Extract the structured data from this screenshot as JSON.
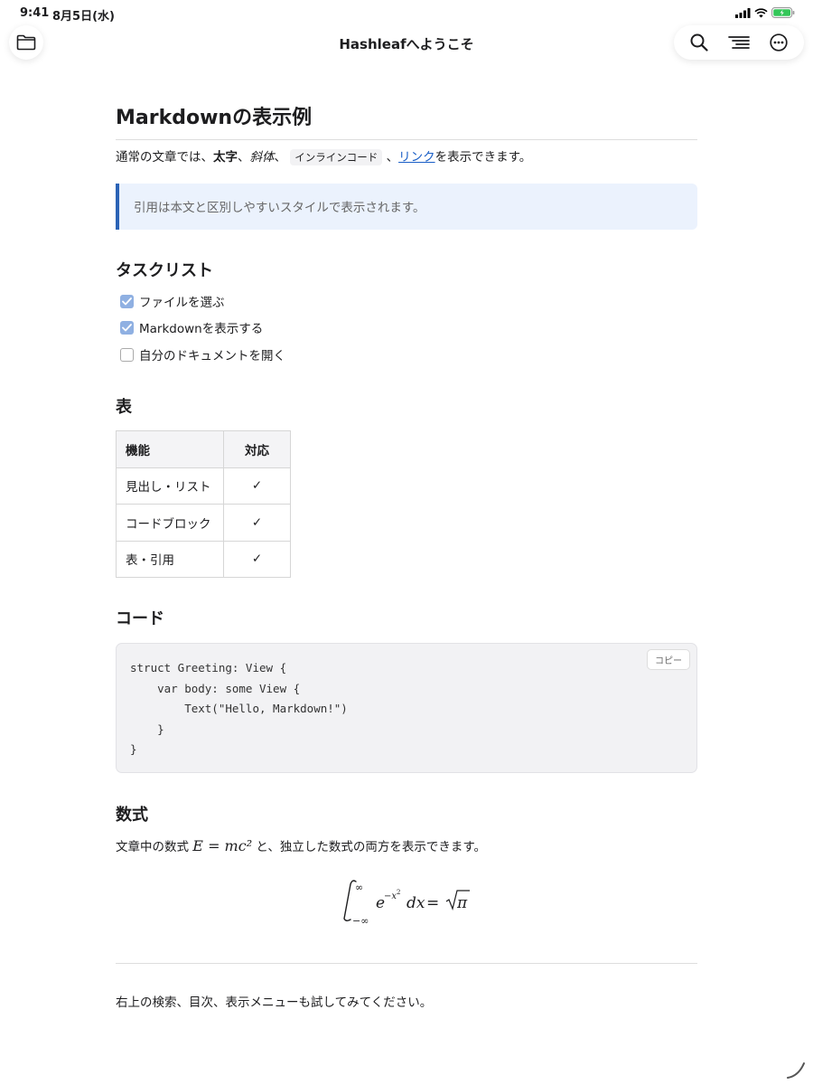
{
  "status": {
    "time": "9:41",
    "date": "8月5日(水)"
  },
  "nav": {
    "title": "Hashleafへようこそ",
    "icons": [
      "folder-icon",
      "search-icon",
      "outline-icon",
      "more-icon"
    ]
  },
  "doc": {
    "h1": "Markdownの表示例",
    "intro": {
      "p1": "通常の文章では、",
      "bold": "太字",
      "p2": "、",
      "italic": "斜体",
      "p3": "、",
      "code": "インラインコード",
      "p4": "、",
      "link": "リンク",
      "p5": "を表示できます。"
    },
    "quote": "引用は本文と区別しやすいスタイルで表示されます。",
    "tasklist": {
      "heading": "タスクリスト",
      "items": [
        {
          "label": "ファイルを選ぶ",
          "checked": true
        },
        {
          "label": "Markdownを表示する",
          "checked": true
        },
        {
          "label": "自分のドキュメントを開く",
          "checked": false
        }
      ]
    },
    "table": {
      "heading": "表",
      "headers": [
        "機能",
        "対応"
      ],
      "rows": [
        [
          "見出し・リスト",
          "✓"
        ],
        [
          "コードブロック",
          "✓"
        ],
        [
          "表・引用",
          "✓"
        ]
      ]
    },
    "code": {
      "heading": "コード",
      "copy_label": "コピー",
      "text": "struct Greeting: View {\n    var body: some View {\n        Text(\"Hello, Markdown!\")\n    }\n}"
    },
    "math": {
      "heading": "数式",
      "p1": "文章中の数式 ",
      "inline": "E = mc²",
      "p2": " と、独立した数式の両方を表示できます。"
    },
    "footer": "右上の検索、目次、表示メニューも試してみてください。"
  },
  "colors": {
    "accent": "#2b63b6",
    "link": "#1a5fc7",
    "quote_bg": "#ebf2fd",
    "code_bg": "#f2f2f4",
    "checkbox_on": "#8fb0e2",
    "battery": "#34c759"
  }
}
